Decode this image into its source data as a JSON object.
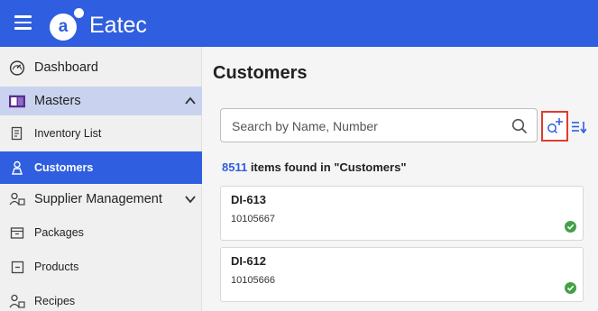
{
  "app": {
    "name": "Eatec",
    "logo_letter": "a"
  },
  "sidebar": {
    "items": [
      {
        "label": "Dashboard"
      },
      {
        "label": "Masters"
      },
      {
        "label": "Inventory List"
      },
      {
        "label": "Customers"
      },
      {
        "label": "Supplier Management"
      },
      {
        "label": "Packages"
      },
      {
        "label": "Products"
      },
      {
        "label": "Recipes"
      }
    ]
  },
  "main": {
    "title": "Customers",
    "search": {
      "placeholder": "Search by Name, Number",
      "value": ""
    },
    "results": {
      "count": "8511",
      "suffix": " items found in \"Customers\""
    },
    "cards": [
      {
        "title": "DI-613",
        "number": "10105667",
        "status": "active"
      },
      {
        "title": "DI-612",
        "number": "10105666",
        "status": "active"
      }
    ]
  },
  "colors": {
    "primary": "#2f5ee0",
    "highlight": "#e03b2e",
    "success": "#43a047",
    "selected_section": "#c9d3f0"
  }
}
